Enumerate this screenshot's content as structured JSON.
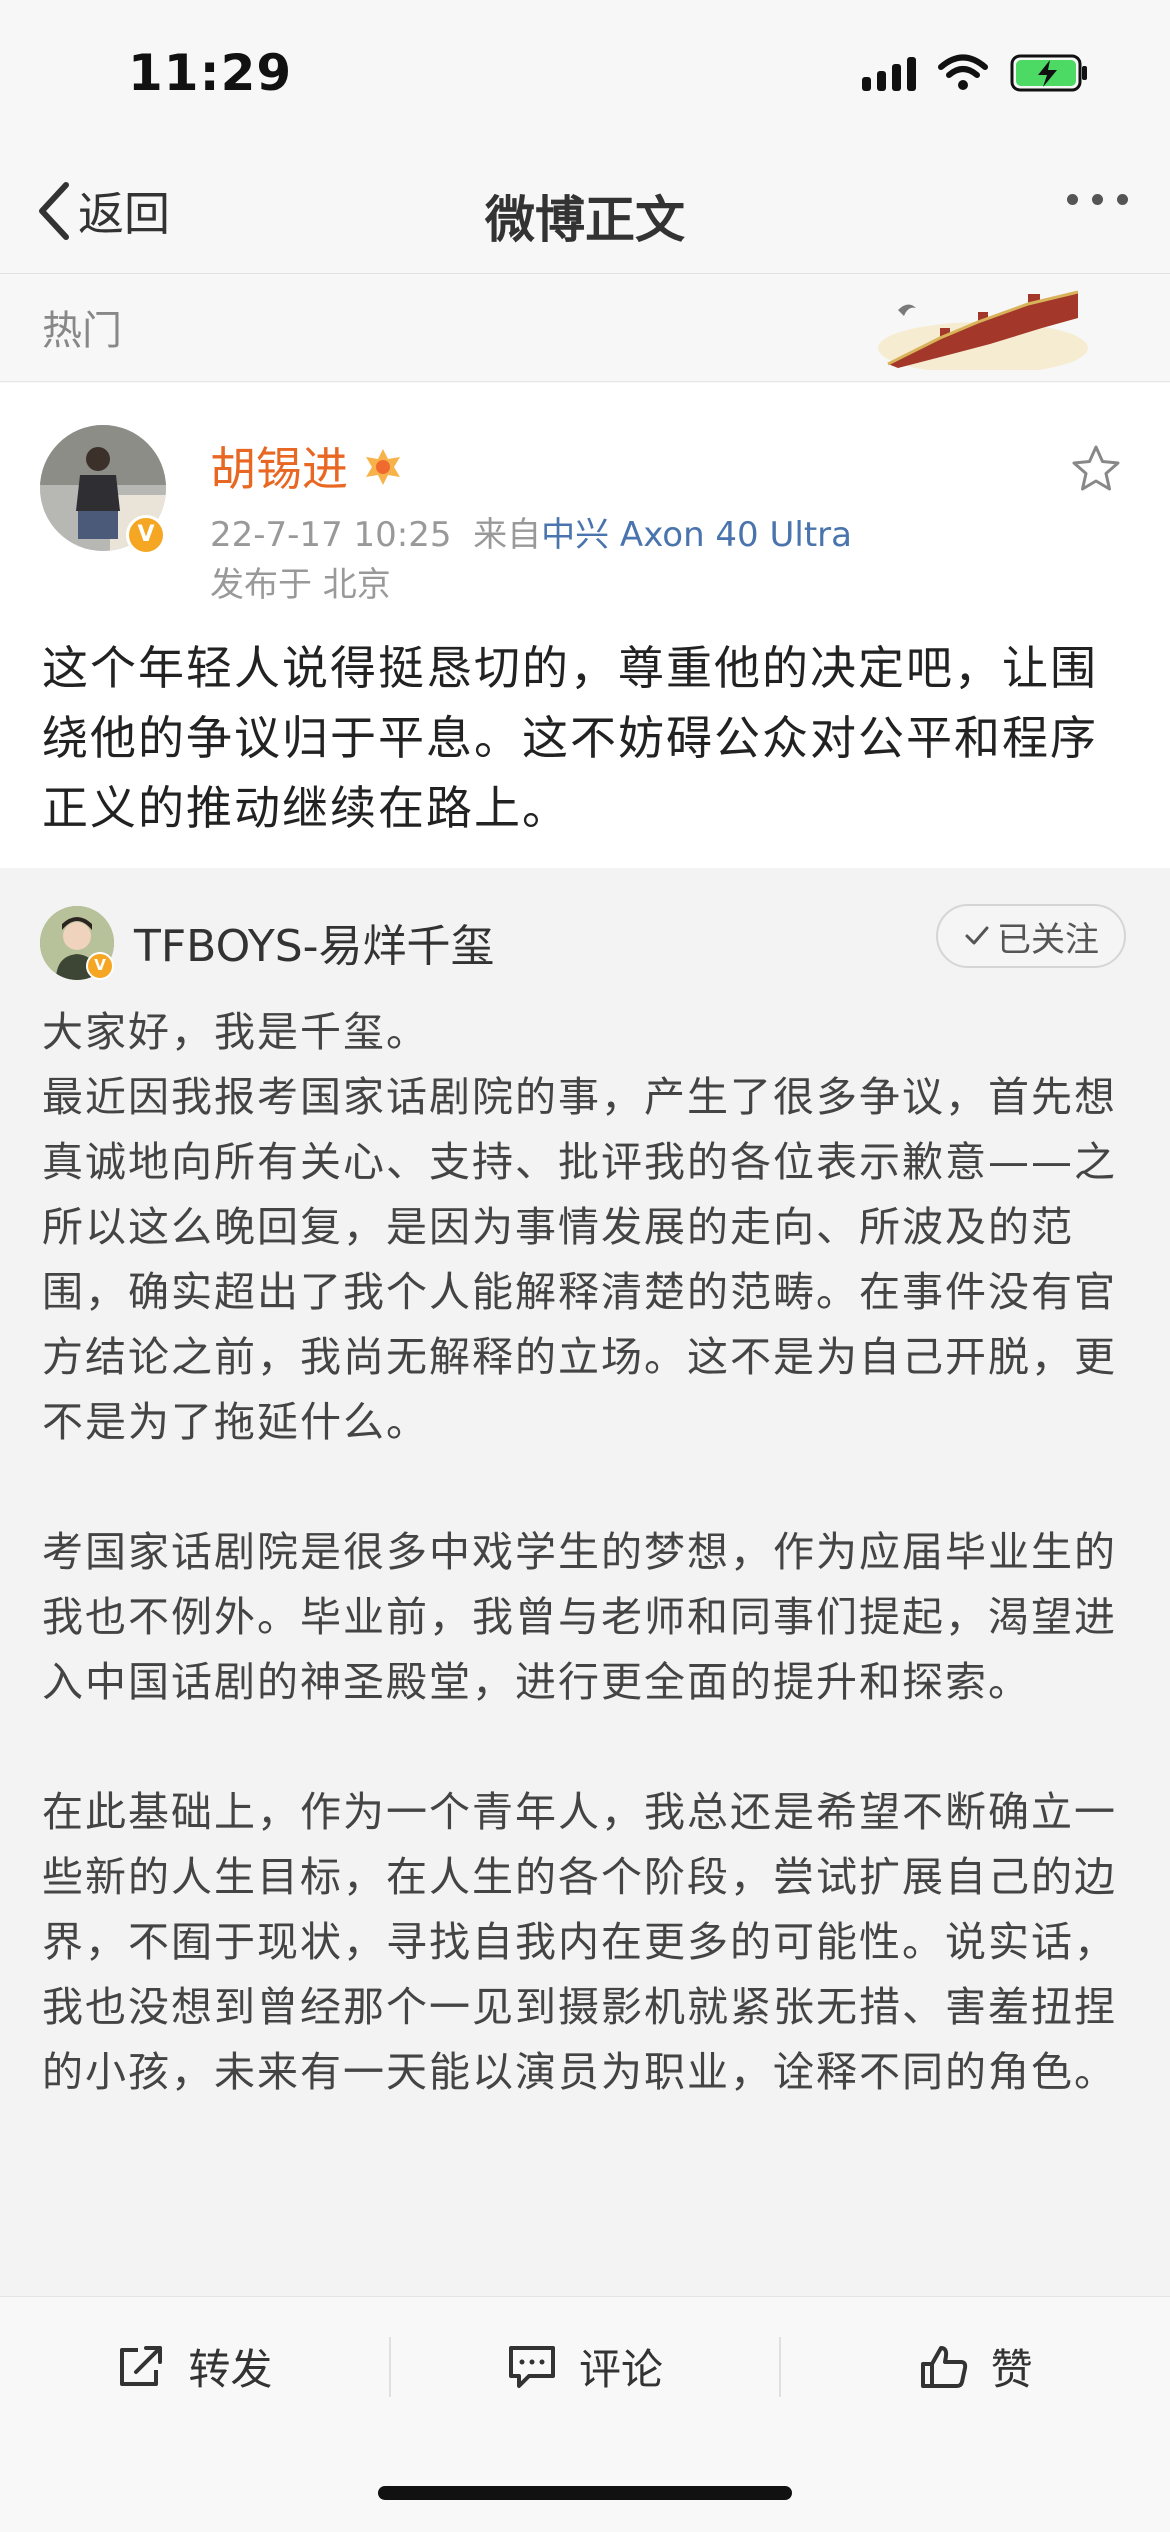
{
  "status_bar": {
    "time": "11:29"
  },
  "nav": {
    "back_label": "返回",
    "title": "微博正文"
  },
  "hot": {
    "label": "热门"
  },
  "post": {
    "author": "胡锡进",
    "timestamp": "22-7-17 10:25",
    "source_prefix": "来自",
    "device": "中兴 Axon 40 Ultra",
    "location": "发布于 北京",
    "text": "这个年轻人说得挺恳切的，尊重他的决定吧，让围绕他的争议归于平息。这不妨碍公众对公平和程序正义的推动继续在路上。"
  },
  "retweet": {
    "author": "TFBOYS-易烊千玺",
    "follow_label": "已关注",
    "text": "大家好，我是千玺。\n最近因我报考国家话剧院的事，产生了很多争议，首先想真诚地向所有关心、支持、批评我的各位表示歉意——之所以这么晚回复，是因为事情发展的走向、所波及的范围，确实超出了我个人能解释清楚的范畴。在事件没有官方结论之前，我尚无解释的立场。这不是为自己开脱，更不是为了拖延什么。\n\n考国家话剧院是很多中戏学生的梦想，作为应届毕业生的我也不例外。毕业前，我曾与老师和同事们提起，渴望进入中国话剧的神圣殿堂，进行更全面的提升和探索。\n\n在此基础上，作为一个青年人，我总还是希望不断确立一些新的人生目标，在人生的各个阶段，尝试扩展自己的边界，不囿于现状，寻找自我内在更多的可能性。说实话，我也没想到曾经那个一见到摄影机就紧张无措、害羞扭捏的小孩，未来有一天能以演员为职业，诠释不同的角色。"
  },
  "actions": {
    "repost": "转发",
    "comment": "评论",
    "like": "赞"
  },
  "icons": {
    "status": [
      "signal-icon",
      "wifi-icon",
      "battery-charging-icon"
    ],
    "nav": [
      "back-chevron-icon",
      "more-icon"
    ],
    "post": [
      "star-icon",
      "verified-badge-icon",
      "medal-icon"
    ],
    "actions": [
      "repost-icon",
      "comment-icon",
      "like-icon"
    ]
  },
  "colors": {
    "author_name": "#e86722",
    "device_link": "#4a74ad",
    "battery": "#4cd964",
    "verified": "#f5a623"
  }
}
